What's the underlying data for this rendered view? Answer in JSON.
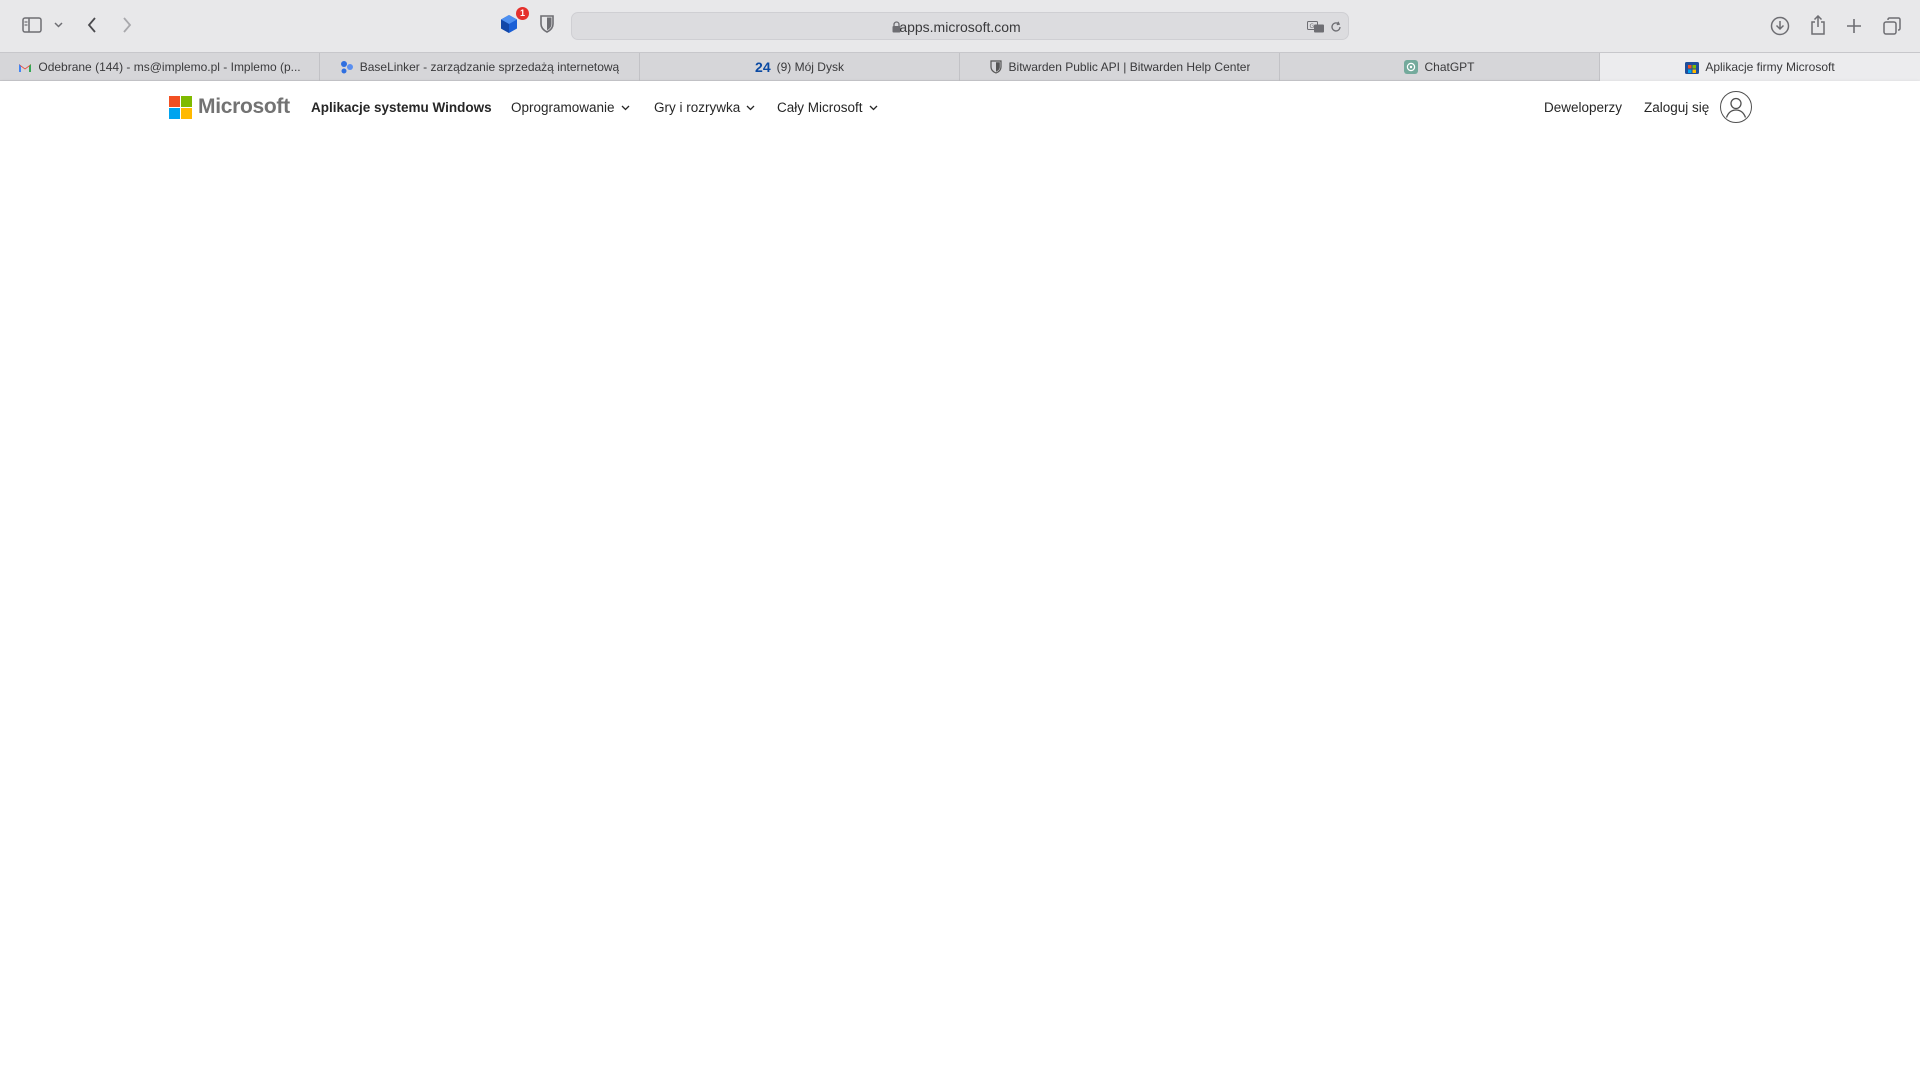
{
  "browser": {
    "address": "apps.microsoft.com",
    "extension_badge": "1",
    "tabs": [
      {
        "label": "Odebrane (144) - ms@implemo.pl - Implemo (p...",
        "icon": "gmail-icon"
      },
      {
        "label": "BaseLinker - zarządzanie sprzedażą internetową",
        "icon": "baselinker-icon"
      },
      {
        "label": "(9) Mój Dysk",
        "icon_text": "24",
        "icon": "dysk-24-icon"
      },
      {
        "label": "Bitwarden Public API | Bitwarden Help Center",
        "icon": "bitwarden-shield-icon"
      },
      {
        "label": "ChatGPT",
        "icon": "chatgpt-icon"
      },
      {
        "label": "Aplikacje firmy Microsoft",
        "icon": "microsoft-store-icon",
        "active": true
      }
    ]
  },
  "header": {
    "brand": "Microsoft",
    "nav": {
      "windows_apps": "Aplikacje systemu Windows",
      "software": "Oprogramowanie",
      "games": "Gry i rozrywka",
      "all_microsoft": "Cały Microsoft"
    },
    "developers": "Deweloperzy",
    "sign_in": "Zaloguj się"
  },
  "colors": {
    "ms_red": "#f25022",
    "ms_green": "#7fba00",
    "ms_blue": "#00a4ef",
    "ms_yellow": "#ffb900"
  }
}
